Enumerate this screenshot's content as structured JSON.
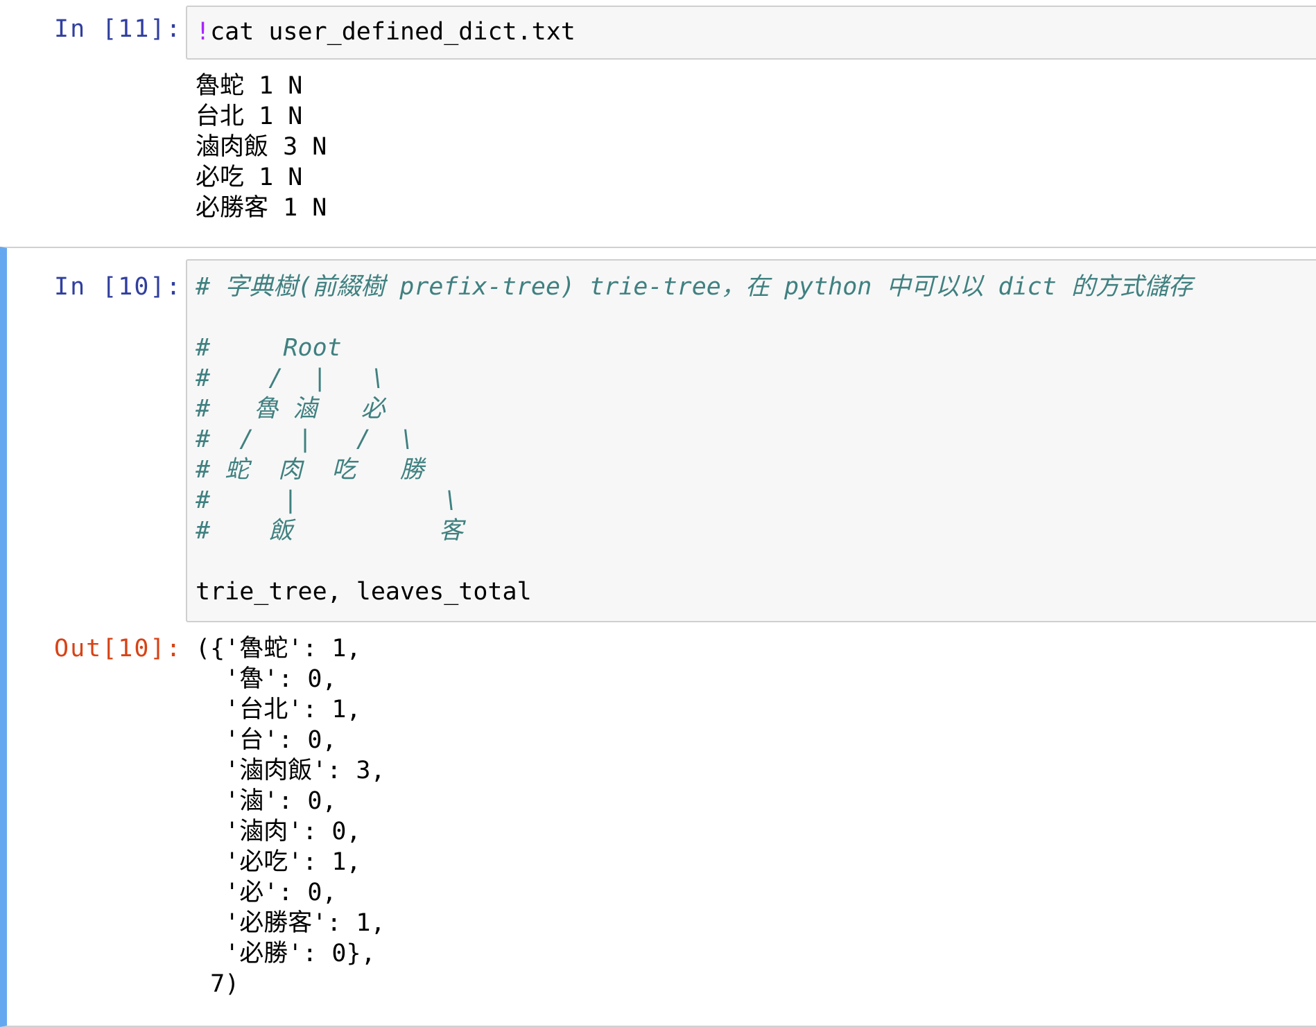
{
  "cell11": {
    "prompt": "In [11]:",
    "magic": "!",
    "command": "cat user_defined_dict.txt",
    "output_lines": [
      "魯蛇 1 N",
      "台北 1 N",
      "滷肉飯 3 N",
      "必吃 1 N",
      "必勝客 1 N"
    ]
  },
  "cell10": {
    "prompt": "In [10]:",
    "comment_lines": [
      "# 字典樹(前綴樹 prefix-tree) trie-tree，在 python 中可以以 dict 的方式儲存",
      "#     Root",
      "#    /  |   \\",
      "#   魯 滷   必",
      "#  /   |   /  \\",
      "# 蛇  肉  吃   勝",
      "#     |          \\",
      "#    飯          客"
    ],
    "code_line": "trie_tree, leaves_total",
    "out_prompt": "Out[10]:",
    "output_lines": [
      "({'魯蛇': 1,",
      "  '魯': 0,",
      "  '台北': 1,",
      "  '台': 0,",
      "  '滷肉飯': 3,",
      "  '滷': 0,",
      "  '滷肉': 0,",
      "  '必吃': 1,",
      "  '必': 0,",
      "  '必勝客': 1,",
      "  '必勝': 0},",
      " 7)"
    ]
  },
  "colors": {
    "in_prompt": "#303f9f",
    "out_prompt": "#d84315",
    "comment": "#408080",
    "magic": "#aa22ff",
    "selected_bar": "#66a8f0",
    "input_bg": "#f7f7f7"
  }
}
